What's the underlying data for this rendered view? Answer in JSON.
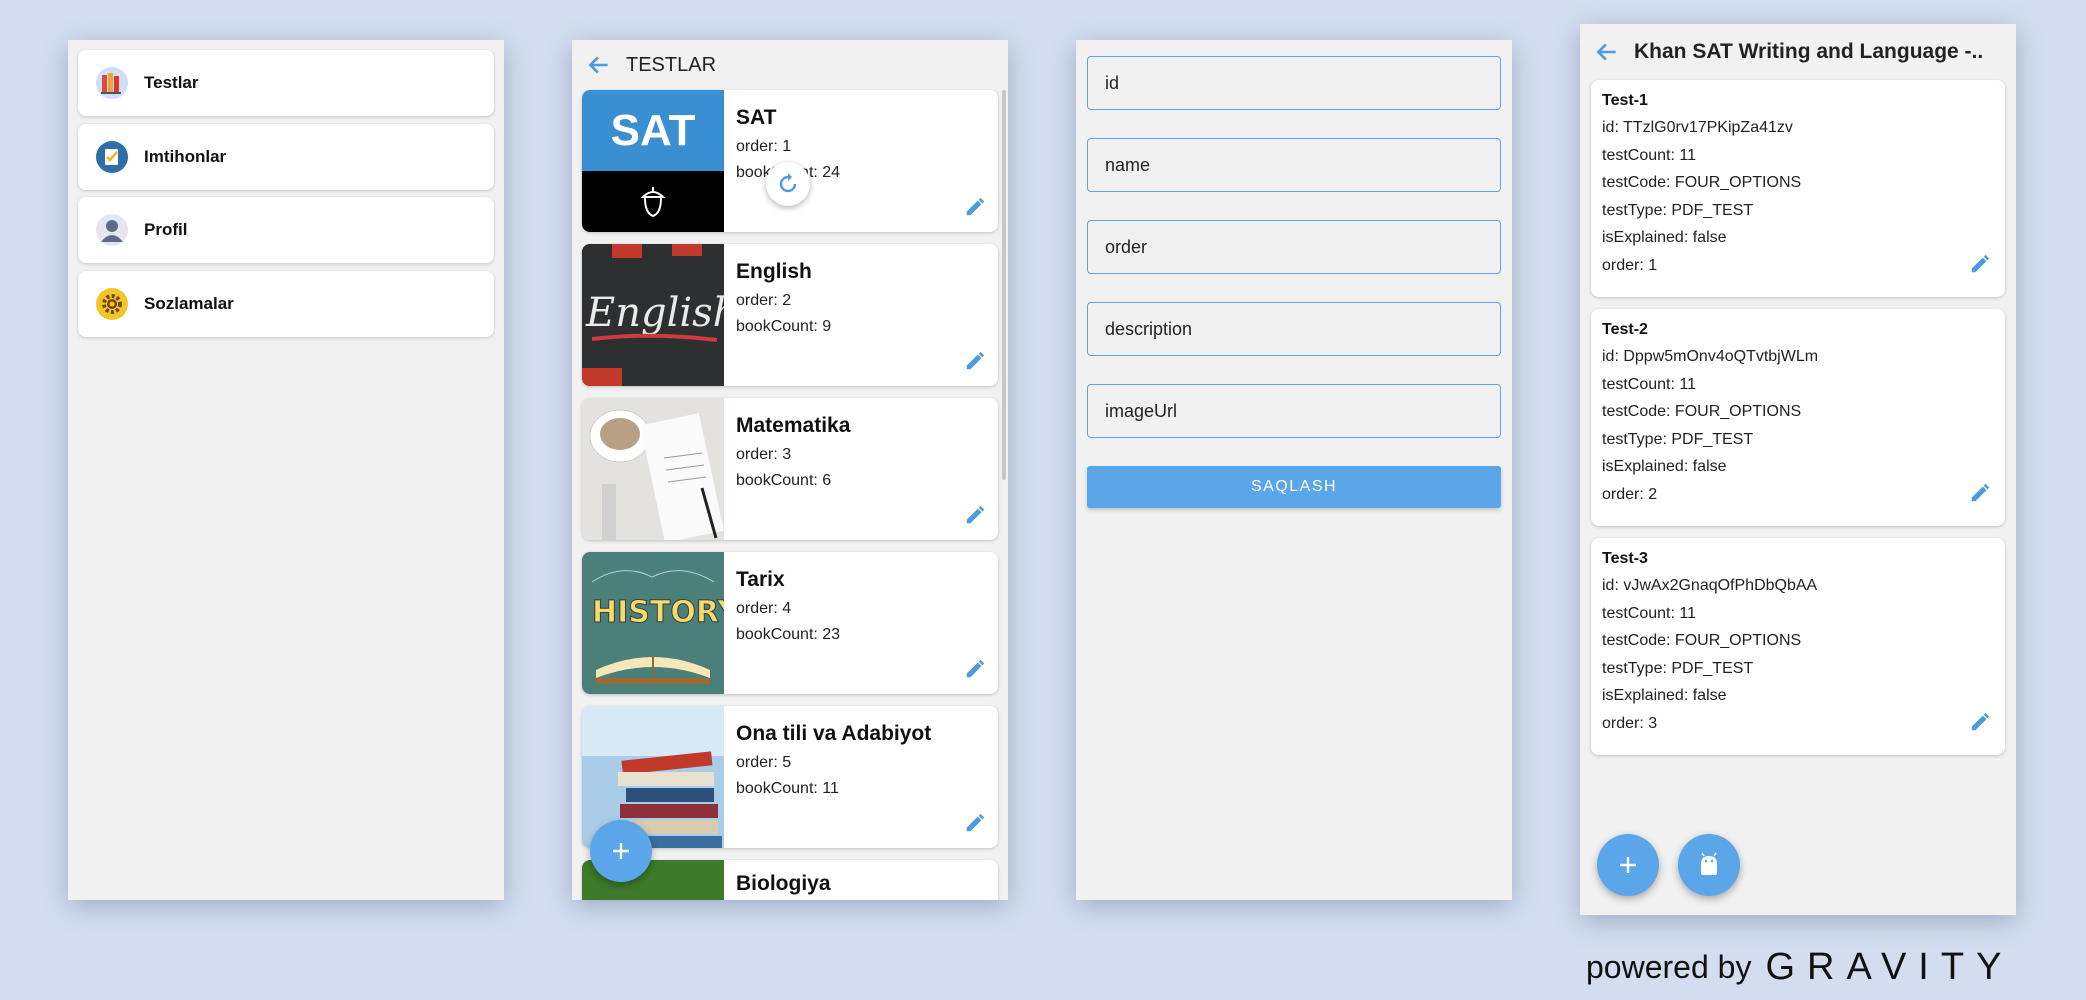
{
  "screen1": {
    "menu": [
      {
        "label": "Testlar",
        "icon": "books-icon"
      },
      {
        "label": "Imtihonlar",
        "icon": "checklist-icon"
      },
      {
        "label": "Profil",
        "icon": "user-icon"
      },
      {
        "label": "Sozlamalar",
        "icon": "gear-icon"
      }
    ]
  },
  "screen2": {
    "title": "TESTLAR",
    "cards": [
      {
        "title": "SAT",
        "order": "order: 1",
        "count": "bookCount: 24",
        "image": "sat-logo"
      },
      {
        "title": "English",
        "order": "order: 2",
        "count": "bookCount: 9",
        "image": "english-chalkboard"
      },
      {
        "title": "Matematika",
        "order": "order: 3",
        "count": "bookCount: 6",
        "image": "desk-notebook"
      },
      {
        "title": "Tarix",
        "order": "order: 4",
        "count": "bookCount: 23",
        "image": "history-book"
      },
      {
        "title": "Ona tili va Adabiyot",
        "order": "order: 5",
        "count": "bookCount: 11",
        "image": "book-stack"
      },
      {
        "title": "Biologiya",
        "order": "",
        "count": "",
        "image": "biology"
      }
    ],
    "sat_logo_text": "SAT"
  },
  "screen3": {
    "fields": [
      {
        "placeholder": "id"
      },
      {
        "placeholder": "name"
      },
      {
        "placeholder": "order"
      },
      {
        "placeholder": "description"
      },
      {
        "placeholder": "imageUrl"
      }
    ],
    "save_label": "SAQLASH"
  },
  "screen4": {
    "title": "Khan SAT Writing and Language -..",
    "tests": [
      {
        "name": "Test-1",
        "id": "id: TTzlG0rv17PKipZa41zv",
        "count": "testCount: 11",
        "code": "testCode: FOUR_OPTIONS",
        "type": "testType: PDF_TEST",
        "explained": "isExplained: false",
        "order": "order: 1"
      },
      {
        "name": "Test-2",
        "id": "id: Dppw5mOnv4oQTvtbjWLm",
        "count": "testCount: 11",
        "code": "testCode: FOUR_OPTIONS",
        "type": "testType: PDF_TEST",
        "explained": "isExplained: false",
        "order": "order: 2"
      },
      {
        "name": "Test-3",
        "id": "id: vJwAx2GnaqOfPhDbQbAA",
        "count": "testCount: 11",
        "code": "testCode: FOUR_OPTIONS",
        "type": "testType: PDF_TEST",
        "explained": "isExplained: false",
        "order": "order: 3"
      }
    ]
  },
  "branding": {
    "powered_by": "powered by",
    "brand": "GRAVITY"
  },
  "colors": {
    "accent": "#5aa6e8",
    "background": "#d2def0",
    "screen": "#f1f1f1"
  }
}
